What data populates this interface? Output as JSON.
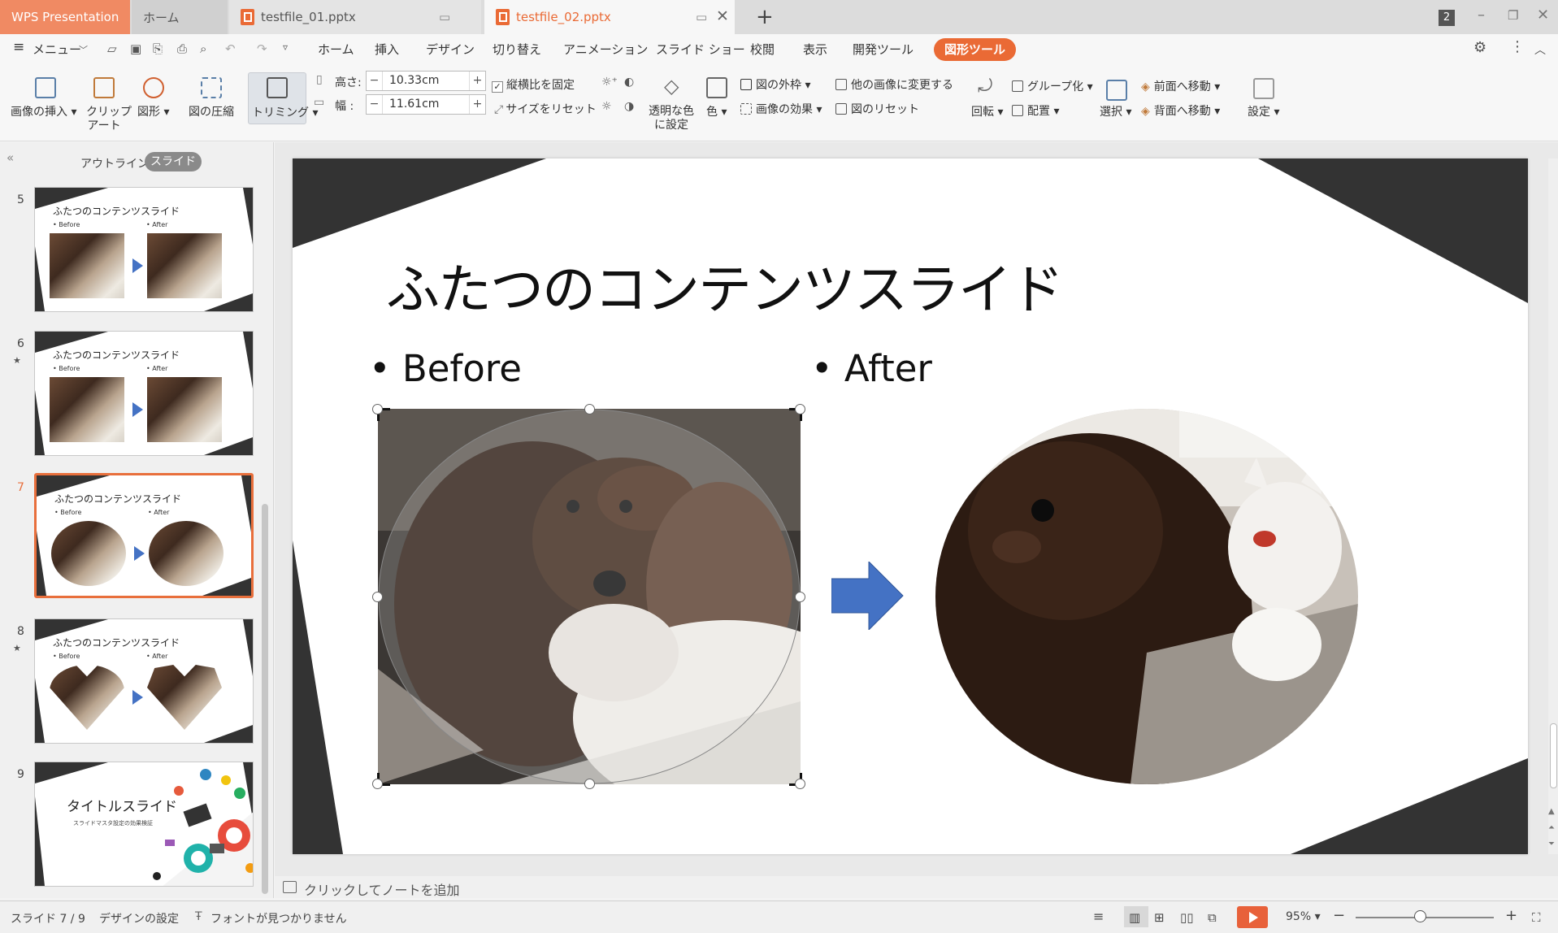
{
  "tabbar": {
    "app_tab": "WPS Presentation",
    "home_tab": "ホーム",
    "file_tabs": [
      "testfile_01.pptx",
      "testfile_02.pptx"
    ],
    "window_badge": "2"
  },
  "menu": {
    "menu_label": "メニュー",
    "tabs": [
      "ホーム",
      "挿入",
      "デザイン",
      "切り替え",
      "アニメーション",
      "スライド ショー",
      "校閲",
      "表示",
      "開発ツール",
      "図形ツール"
    ],
    "active_tab": "図形ツール"
  },
  "ribbon": {
    "insert_image": "画像の挿入",
    "clipart_line1": "クリップ",
    "clipart_line2": "アート",
    "shape": "図形",
    "compress": "図の圧縮",
    "trim": "トリミング",
    "height_label": "高さ:",
    "width_label": "幅 :",
    "height_value": "10.33cm",
    "width_value": "11.61cm",
    "lock_ratio": "縦横比を固定",
    "reset_size": "サイズをリセット",
    "transparent_line1": "透明な色",
    "transparent_line2": "に設定",
    "color": "色",
    "outline": "図の外枠",
    "effects": "画像の効果",
    "change_image": "他の画像に変更する",
    "reset_image": "図のリセット",
    "rotate": "回転",
    "group": "グループ化",
    "align": "配置",
    "select": "選択",
    "bring_forward": "前面へ移動",
    "send_backward": "背面へ移動",
    "settings": "設定"
  },
  "panel": {
    "outline_tab": "アウトライン",
    "slides_tab": "スライド",
    "thumbs": [
      {
        "num": "5",
        "title": "ふたつのコンテンツスライド",
        "before": "• Before",
        "after": "• After"
      },
      {
        "num": "6",
        "title": "ふたつのコンテンツスライド",
        "before": "• Before",
        "after": "• After"
      },
      {
        "num": "7",
        "title": "ふたつのコンテンツスライド",
        "before": "• Before",
        "after": "• After"
      },
      {
        "num": "8",
        "title": "ふたつのコンテンツスライド",
        "before": "• Before",
        "after": "• After"
      },
      {
        "num": "9",
        "title": "タイトルスライド",
        "subtitle": "スライドマスタ設定の効果検証"
      }
    ],
    "selected": "7"
  },
  "slide": {
    "title": "ふたつのコンテンツスライド",
    "before_label": "• Before",
    "after_label": "• After",
    "arrow_color": "#4472c4"
  },
  "notes": {
    "placeholder": "クリックしてノートを追加"
  },
  "status": {
    "slide_pos": "スライド 7 / 9",
    "design": "デザインの設定",
    "font_warning": "フォントが見つかりません",
    "zoom": "95%"
  },
  "colors": {
    "accent": "#ea6a35",
    "dark_shape": "#333333"
  }
}
